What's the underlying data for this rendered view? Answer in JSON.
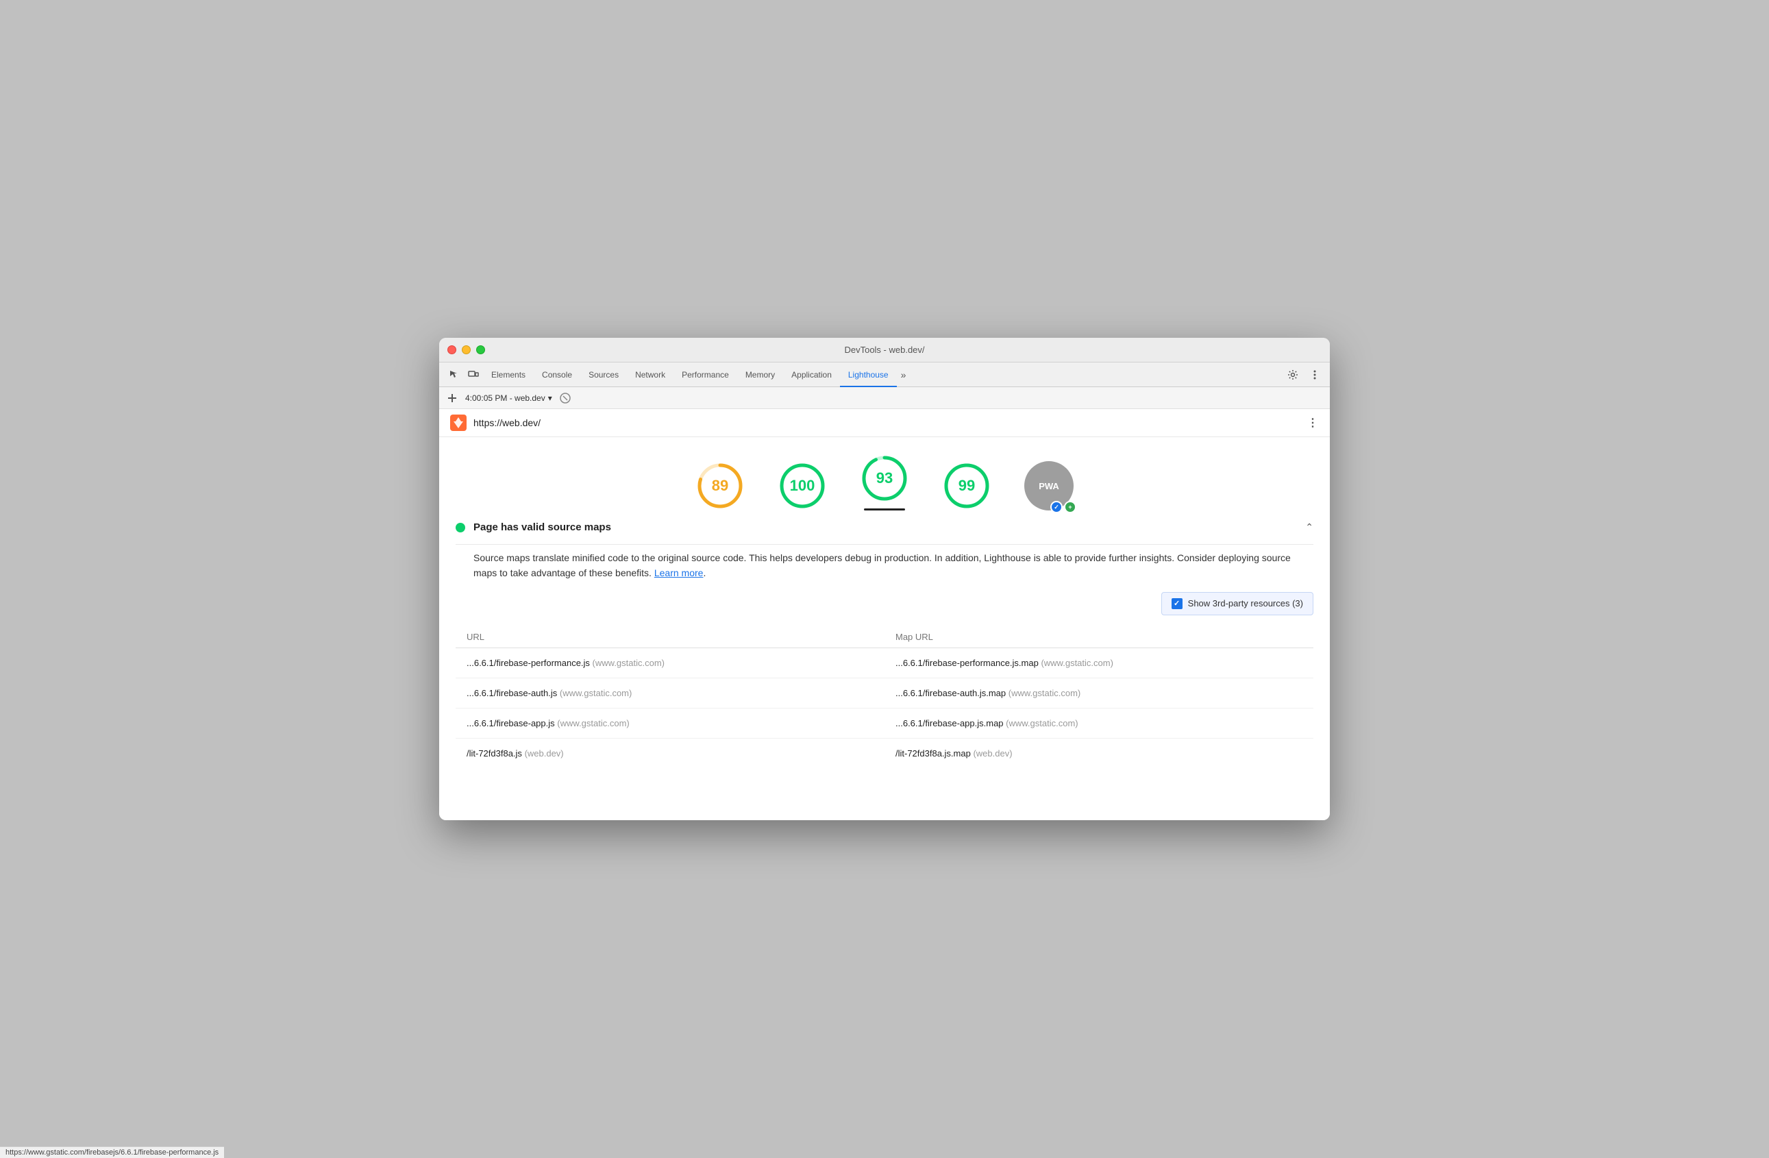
{
  "window": {
    "title": "DevTools - web.dev/"
  },
  "trafficLights": {
    "red": "close",
    "yellow": "minimize",
    "green": "maximize"
  },
  "tabs": [
    {
      "label": "Elements",
      "active": false
    },
    {
      "label": "Console",
      "active": false
    },
    {
      "label": "Sources",
      "active": false
    },
    {
      "label": "Network",
      "active": false
    },
    {
      "label": "Performance",
      "active": false
    },
    {
      "label": "Memory",
      "active": false
    },
    {
      "label": "Application",
      "active": false
    },
    {
      "label": "Lighthouse",
      "active": true
    }
  ],
  "toolbar": {
    "session": "4:00:05 PM - web.dev",
    "sessionDropdown": "▾"
  },
  "urlBar": {
    "url": "https://web.dev/",
    "moreLabel": "⋮"
  },
  "scores": [
    {
      "value": "89",
      "color": "#f4a922",
      "trackColor": "#fde8c0",
      "angle": 320,
      "underline": false
    },
    {
      "value": "100",
      "color": "#0cce6b",
      "trackColor": "#c6f5dd",
      "angle": 360,
      "underline": false
    },
    {
      "value": "93",
      "color": "#0cce6b",
      "trackColor": "#c6f5dd",
      "angle": 335,
      "underline": true
    },
    {
      "value": "99",
      "color": "#0cce6b",
      "trackColor": "#c6f5dd",
      "angle": 356,
      "underline": false
    }
  ],
  "audit": {
    "status": "pass",
    "title": "Page has valid source maps",
    "description": "Source maps translate minified code to the original source code. This helps developers debug in production. In addition, Lighthouse is able to provide further insights. Consider deploying source maps to take advantage of these benefits.",
    "learnMoreText": "Learn more",
    "learnMoreUrl": "#",
    "periodAfterLink": "."
  },
  "checkboxOption": {
    "label": "Show 3rd-party resources (3)",
    "checked": true
  },
  "tableHeaders": {
    "url": "URL",
    "mapUrl": "Map URL"
  },
  "tableRows": [
    {
      "url": "...6.6.1/firebase-performance.js",
      "urlDomain": "(www.gstatic.com)",
      "mapUrl": "...6.6.1/firebase-performance.js.map",
      "mapDomain": "(www.gstatic.com)"
    },
    {
      "url": "...6.6.1/firebase-auth.js",
      "urlDomain": "(www.gstatic.com)",
      "mapUrl": "...6.6.1/firebase-auth.js.map",
      "mapDomain": "(www.gstatic.com)"
    },
    {
      "url": "...6.6.1/firebase-app.js",
      "urlDomain": "(www.gstatic.com)",
      "mapUrl": "...6.6.1/firebase-app.js.map",
      "mapDomain": "(www.gstatic.com)"
    },
    {
      "url": "/lit-72fd3f8a.js",
      "urlDomain": "(web.dev)",
      "mapUrl": "/lit-72fd3f8a.js.map",
      "mapDomain": "(web.dev)"
    }
  ],
  "statusbar": {
    "url": "https://www.gstatic.com/firebasejs/6.6.1/firebase-performance.js"
  }
}
